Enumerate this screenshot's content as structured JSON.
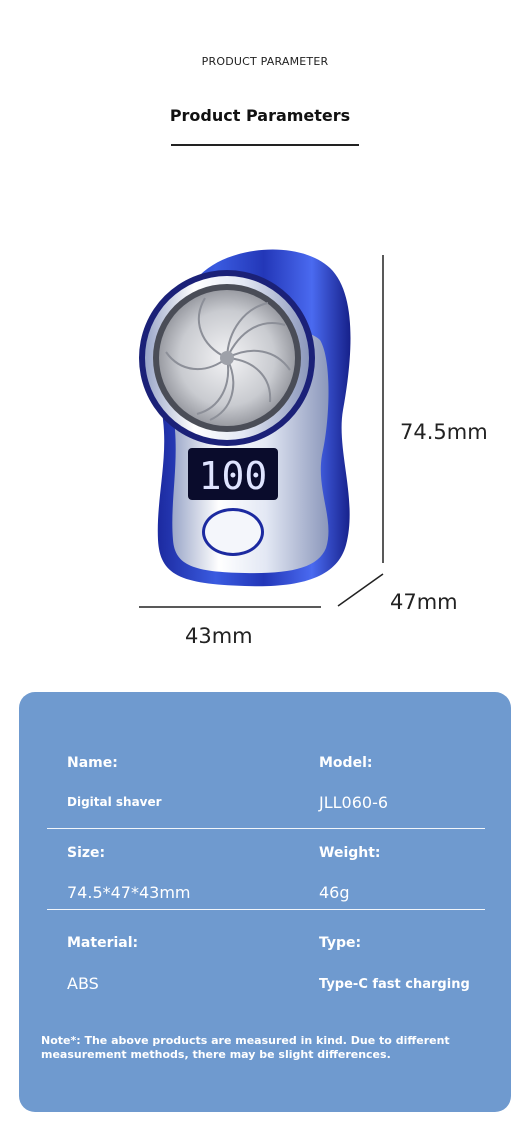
{
  "header": {
    "small_title": "PRODUCT PARAMETER",
    "title": "Product Parameters"
  },
  "product": {
    "display_reading": "100",
    "dimensions": {
      "height": "74.5mm",
      "depth": "47mm",
      "width": "43mm"
    },
    "colors": {
      "body": "#2a3fb0",
      "display_digits": "#dfe4ff"
    }
  },
  "specs": {
    "name_label": "Name:",
    "name_value": "Digital shaver",
    "model_label": "Model:",
    "model_value": "JLL060-6",
    "size_label": "Size:",
    "size_value": "74.5*47*43mm",
    "weight_label": "Weight:",
    "weight_value": "46g",
    "material_label": "Material:",
    "material_value": "ABS",
    "type_label": "Type:",
    "type_value": "Type-C fast charging"
  },
  "note": "Note*: The above products are measured in kind. Due to different measurement methods, there may be slight differences.",
  "theme": {
    "card_background": "#6f9acf"
  }
}
